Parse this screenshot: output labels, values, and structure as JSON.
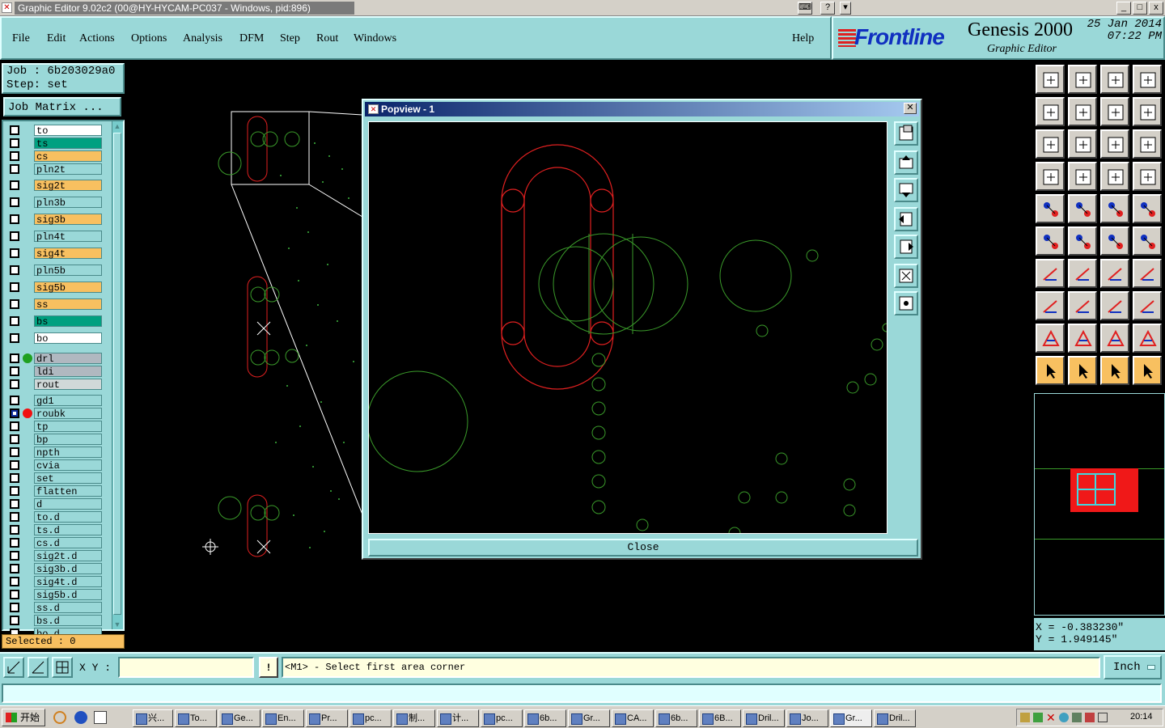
{
  "window": {
    "title": "Graphic Editor 9.02c2 (00@HY-HYCAM-PC037 - Windows, pid:896)",
    "min": "_",
    "max": "□",
    "close": "x"
  },
  "menu": {
    "items": [
      {
        "label": "File"
      },
      {
        "label": "Edit"
      },
      {
        "label": "Actions"
      },
      {
        "label": "Options"
      },
      {
        "label": "Analysis"
      },
      {
        "label": "DFM"
      },
      {
        "label": "Step"
      },
      {
        "label": "Rout"
      },
      {
        "label": "Windows"
      }
    ],
    "help": "Help"
  },
  "brand": {
    "logo": "Frontline",
    "product": "Genesis 2000",
    "sub": "Graphic Editor",
    "date": "25 Jan 2014",
    "time": "07:22 PM"
  },
  "job": {
    "job_line": "Job : 6b203029a0",
    "step_line": "Step: set",
    "matrix_button": "Job Matrix ..."
  },
  "layers": [
    {
      "name": "to",
      "color": "#ffffff"
    },
    {
      "name": "ts",
      "color": "#00a080"
    },
    {
      "name": "cs",
      "color": "#f8c060"
    },
    {
      "name": "pln2t",
      "color": "#9ad8d8"
    },
    {
      "name": "sig2t",
      "color": "#f8c060"
    },
    {
      "name": "pln3b",
      "color": "#9ad8d8"
    },
    {
      "name": "sig3b",
      "color": "#f8c060"
    },
    {
      "name": "pln4t",
      "color": "#9ad8d8"
    },
    {
      "name": "sig4t",
      "color": "#f8c060"
    },
    {
      "name": "pln5b",
      "color": "#9ad8d8"
    },
    {
      "name": "sig5b",
      "color": "#f8c060"
    },
    {
      "name": "ss",
      "color": "#f8c060"
    },
    {
      "name": "bs",
      "color": "#00a080"
    },
    {
      "name": "bo",
      "color": "#ffffff"
    },
    {
      "name": "drl",
      "color": "#b0b8c0"
    },
    {
      "name": "ldi",
      "color": "#b0b8c0"
    },
    {
      "name": "rout",
      "color": "#d0d8d8"
    },
    {
      "name": "gd1",
      "color": "#9ad8d8"
    },
    {
      "name": "roubk",
      "color": "#9ad8d8"
    },
    {
      "name": "tp",
      "color": "#9ad8d8"
    },
    {
      "name": "bp",
      "color": "#9ad8d8"
    },
    {
      "name": "npth",
      "color": "#9ad8d8"
    },
    {
      "name": "cvia",
      "color": "#9ad8d8"
    },
    {
      "name": "set",
      "color": "#9ad8d8"
    },
    {
      "name": "flatten",
      "color": "#9ad8d8"
    },
    {
      "name": "d",
      "color": "#9ad8d8"
    },
    {
      "name": "to.d",
      "color": "#9ad8d8"
    },
    {
      "name": "ts.d",
      "color": "#9ad8d8"
    },
    {
      "name": "cs.d",
      "color": "#9ad8d8"
    },
    {
      "name": "sig2t.d",
      "color": "#9ad8d8"
    },
    {
      "name": "sig3b.d",
      "color": "#9ad8d8"
    },
    {
      "name": "sig4t.d",
      "color": "#9ad8d8"
    },
    {
      "name": "sig5b.d",
      "color": "#9ad8d8"
    },
    {
      "name": "ss.d",
      "color": "#9ad8d8"
    },
    {
      "name": "bs.d",
      "color": "#9ad8d8"
    },
    {
      "name": "bo.d",
      "color": "#9ad8d8"
    }
  ],
  "selected": "Selected : 0",
  "popup": {
    "title": "Popview - 1",
    "close_label": "Close"
  },
  "coords": {
    "x": "X = -0.383230\"",
    "y": "Y = 1.949145\""
  },
  "status": {
    "xy_label": "X Y :",
    "xy_value": "",
    "prompt": "<M1> - Select first area corner",
    "units": "Inch"
  },
  "taskbar": {
    "start": "开始",
    "tasks": [
      "兴...",
      "To...",
      "Ge...",
      "En...",
      "Pr...",
      "pc...",
      "制...",
      "计...",
      "pc...",
      "6b...",
      "Gr...",
      "CA...",
      "6b...",
      "6B...",
      "Dril...",
      "Jo...",
      "Gr...",
      "Dril..."
    ],
    "clock": "20:14"
  },
  "colors": {
    "accent": "#9ad8d8",
    "outline_red": "#e02020",
    "pad_green": "#3a9a2a"
  }
}
